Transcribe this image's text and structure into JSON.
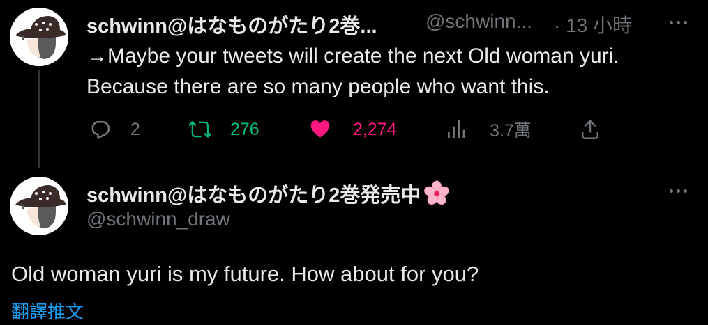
{
  "reply_tweet": {
    "display_name": "schwinn@はなものがたり2巻...",
    "handle": "@schwinn...",
    "timestamp": "· 13 小時",
    "text_lines": [
      "→Maybe your tweets will create the next Old woman yuri.",
      "Because there are so many people who want this."
    ],
    "actions": {
      "replies": "2",
      "retweets": "276",
      "likes": "2,274",
      "views": "3.7萬"
    }
  },
  "main_tweet": {
    "display_name": "schwinn@はなものがたり2巻発売中",
    "name_emoji": "cherry-blossom-icon",
    "handle": "@schwinn_draw",
    "text": "Old woman yuri is my future. How about for you?",
    "translate_link": "翻譯推文"
  },
  "colors": {
    "background": "#000000",
    "primary_text": "#e7e9ea",
    "secondary_text": "#71767b",
    "retweet_green": "#00ba7c",
    "like_pink": "#f91880",
    "link_blue": "#1d9bf0"
  },
  "icons": [
    "reply-icon",
    "retweet-icon",
    "heart-icon",
    "views-icon",
    "share-icon",
    "more-icon",
    "avatar"
  ]
}
